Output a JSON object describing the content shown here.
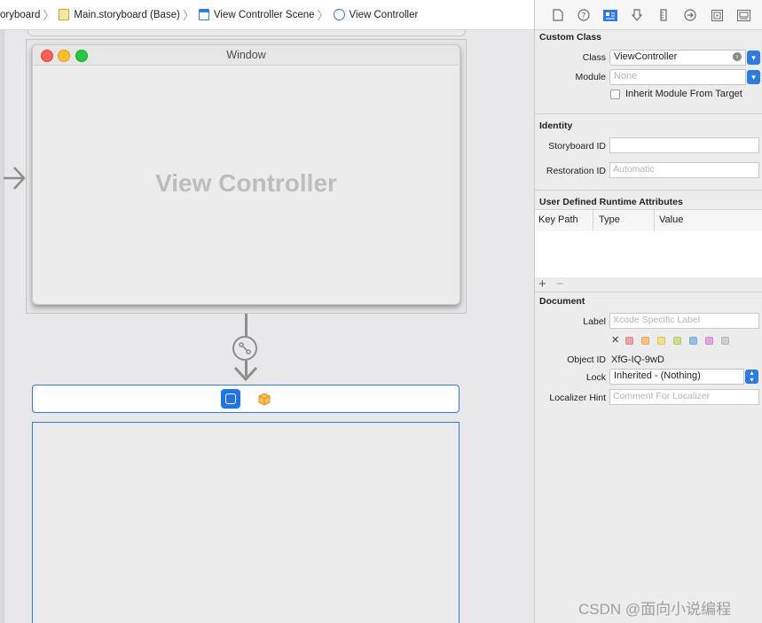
{
  "breadcrumb": {
    "items": [
      {
        "label": "oryboard",
        "icon": "storyboard-icon"
      },
      {
        "label": "Main.storyboard (Base)",
        "icon": "file-icon"
      },
      {
        "label": "View Controller Scene",
        "icon": "scene-icon"
      },
      {
        "label": "View Controller",
        "icon": "view-controller-icon"
      }
    ]
  },
  "canvas": {
    "window_title": "Window",
    "content_label": "View Controller"
  },
  "inspector": {
    "tab_icons": [
      "file-inspector-icon",
      "help-icon",
      "identity-inspector-icon",
      "attributes-inspector-icon",
      "size-inspector-icon",
      "connections-inspector-icon",
      "bindings-inspector-icon",
      "view-effects-inspector-icon"
    ],
    "custom_class": {
      "title": "Custom Class",
      "class_label": "Class",
      "class_value": "ViewController",
      "module_label": "Module",
      "module_placeholder": "None",
      "inherit_label": "Inherit Module From Target"
    },
    "identity": {
      "title": "Identity",
      "storyboard_id_label": "Storyboard ID",
      "storyboard_id_value": "",
      "restoration_id_label": "Restoration ID",
      "restoration_id_placeholder": "Automatic"
    },
    "runtime_attributes": {
      "title": "User Defined Runtime Attributes",
      "columns": [
        "Key Path",
        "Type",
        "Value"
      ],
      "add": "+",
      "remove": "−"
    },
    "document": {
      "title": "Document",
      "label_label": "Label",
      "label_placeholder": "Xcode Specific Label",
      "clear_color": "✕",
      "colors": [
        "#f1a3a3",
        "#f5c27f",
        "#f2e37a",
        "#c8e38b",
        "#8fc2ee",
        "#e2a6e6",
        "#cfcfcf"
      ],
      "object_id_label": "Object ID",
      "object_id_value": "XfG-IQ-9wD",
      "lock_label": "Lock",
      "lock_value": "Inherited - (Nothing)",
      "localizer_label": "Localizer Hint",
      "localizer_placeholder": "Comment For Localizer"
    }
  },
  "watermark": "CSDN @面向小说编程"
}
